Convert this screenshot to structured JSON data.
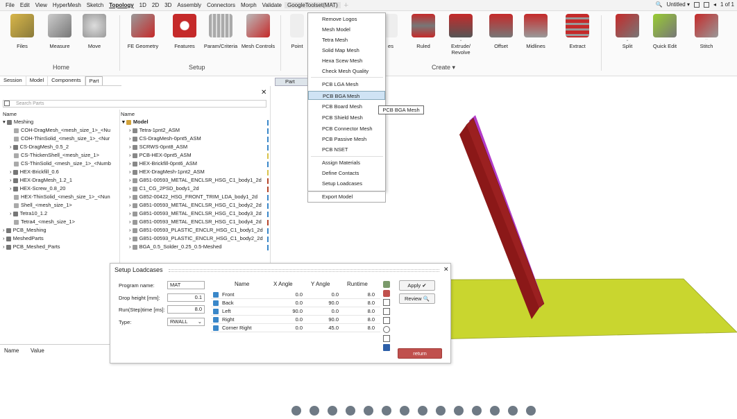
{
  "menubar": {
    "items": [
      "File",
      "Edit",
      "View",
      "HyperMesh",
      "Sketch",
      "Topology",
      "1D",
      "2D",
      "3D",
      "Assembly",
      "Connectors",
      "Morph",
      "Validate",
      "GoogleToolset(MAT)"
    ],
    "untitled": "Untitled ▾",
    "pages": "1 of 1"
  },
  "ribbon": {
    "tools": [
      {
        "label": "Files"
      },
      {
        "label": "Measure"
      },
      {
        "label": "Move"
      },
      {
        "label": "FE Geometry"
      },
      {
        "label": "Features"
      },
      {
        "label": "Param/Criteria"
      },
      {
        "label": "Mesh Controls"
      },
      {
        "label": "Point"
      },
      {
        "label": "es"
      },
      {
        "label": "Ruled"
      },
      {
        "label": "Extrude/ Revolve"
      },
      {
        "label": "Offset"
      },
      {
        "label": "Midlines"
      },
      {
        "label": "Extract"
      },
      {
        "label": "Split"
      },
      {
        "label": "Quick Edit"
      },
      {
        "label": "Stitch"
      }
    ],
    "groups": {
      "home": "Home",
      "setup": "Setup",
      "create": "Create ▾"
    }
  },
  "panel_tabs": [
    "Session",
    "Model",
    "Components",
    "Part"
  ],
  "search_placeholder": "Search Parts",
  "left_tree": {
    "header": "Name",
    "items": [
      "Meshing",
      "COH-DragMesh_<mesh_size_1>_<Nu",
      "COH-ThinSolid_<mesh_size_1>_<Nur",
      "CS-DragMesh_0.5_2",
      "CS-ThickenShell_<mesh_size_1>",
      "CS-ThinSolid_<mesh_size_1>_<Numb",
      "HEX-Brickfill_0.6",
      "HEX-DragMesh_1.2_1",
      "HEX-Screw_0.8_20",
      "HEX-ThinSolid_<mesh_size_1>_<Nun",
      "Shell_<mesh_size_1>",
      "Tetra10_1.2",
      "Tetra4_<mesh_size_1>",
      "PCB_Meshing",
      "MeshedParts",
      "PCB_Meshed_Parts"
    ]
  },
  "right_tree": {
    "header": "Name",
    "items": [
      "Model",
      "Tetra-1pnt2_ASM",
      "CS-DragMesh-0pnt5_ASM",
      "SCRWS-0pnt8_ASM",
      "PCB-HEX-0pnt5_ASM",
      "HEX-Brickfill-0pnt6_ASM",
      "HEX-DragMesh-1pnt2_ASM",
      "G851-00593_METAL_ENCLSR_HSG_C1_body1_2d",
      "C1_CG_2PSD_body1_2d",
      "G852-00422_HSG_FRONT_TRIM_LDA_body1_2d",
      "G851-00593_METAL_ENCLSR_HSG_C1_body2_2d",
      "G851-00593_METAL_ENCLSR_HSG_C1_body3_2d",
      "G851-00593_METAL_ENCLSR_HSG_C1_body4_2d",
      "G851-00593_PLASTIC_ENCLR_HSG_C1_body1_2d",
      "G851-00593_PLASTIC_ENCLR_HSG_C1_body2_2d",
      "BGA_0.5_Solder_0.25_0.5-Meshed"
    ]
  },
  "props": {
    "name": "Name",
    "value": "Value"
  },
  "viewport_tab": "Part",
  "tool_menu": {
    "items": [
      "Remove Logos",
      "Mesh Model",
      "Tetra Mesh",
      "Solid Map Mesh",
      "Hexa Scew Mesh",
      "Check Mesh Quality",
      "PCB LGA Mesh",
      "PCB BGA Mesh",
      "PCB Board Mesh",
      "PCB Shield Mesh",
      "PCB Connector Mesh",
      "PCB Passive Mesh",
      "PCB NSET",
      "Assign Materials",
      "Define Contacts",
      "Setup Loadcases",
      "Export Model"
    ],
    "highlighted": "PCB BGA Mesh"
  },
  "tooltip": "PCB BGA Mesh",
  "dialog": {
    "title": "Setup Loadcases",
    "program_label": "Program name:",
    "program_value": "MAT",
    "drop_label": "Drop height [mm]:",
    "drop_value": "0.1",
    "run_label": "Run(Step)time [ms]:",
    "run_value": "8.0",
    "type_label": "Type:",
    "type_value": "RWALL",
    "columns": [
      "Name",
      "X Angle",
      "Y Angle",
      "Runtime"
    ],
    "rows": [
      [
        "Front",
        "0.0",
        "0.0",
        "8.0"
      ],
      [
        "Back",
        "0.0",
        "90.0",
        "8.0"
      ],
      [
        "Left",
        "90.0",
        "0.0",
        "8.0"
      ],
      [
        "Right",
        "0.0",
        "90.0",
        "8.0"
      ],
      [
        "Corner Right",
        "0.0",
        "45.0",
        "8.0"
      ]
    ],
    "apply": "Apply ✔",
    "review": "Review 🔍",
    "return": "return"
  },
  "colors": {
    "phone": "#9b2020",
    "phone_edge": "#b23bc7",
    "floor": "#c9d62f",
    "highlight": "#cfe3f4"
  }
}
